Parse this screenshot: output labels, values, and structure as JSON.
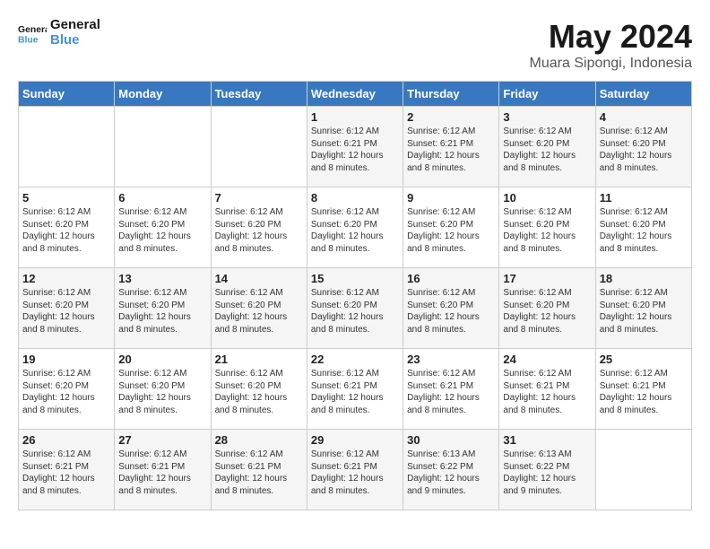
{
  "logo": {
    "line1": "General",
    "line2": "Blue"
  },
  "title": "May 2024",
  "subtitle": "Muara Sipongi, Indonesia",
  "days_of_week": [
    "Sunday",
    "Monday",
    "Tuesday",
    "Wednesday",
    "Thursday",
    "Friday",
    "Saturday"
  ],
  "weeks": [
    [
      {
        "day": "",
        "info": ""
      },
      {
        "day": "",
        "info": ""
      },
      {
        "day": "",
        "info": ""
      },
      {
        "day": "1",
        "info": "Sunrise: 6:12 AM\nSunset: 6:21 PM\nDaylight: 12 hours\nand 8 minutes."
      },
      {
        "day": "2",
        "info": "Sunrise: 6:12 AM\nSunset: 6:21 PM\nDaylight: 12 hours\nand 8 minutes."
      },
      {
        "day": "3",
        "info": "Sunrise: 6:12 AM\nSunset: 6:20 PM\nDaylight: 12 hours\nand 8 minutes."
      },
      {
        "day": "4",
        "info": "Sunrise: 6:12 AM\nSunset: 6:20 PM\nDaylight: 12 hours\nand 8 minutes."
      }
    ],
    [
      {
        "day": "5",
        "info": "Sunrise: 6:12 AM\nSunset: 6:20 PM\nDaylight: 12 hours\nand 8 minutes."
      },
      {
        "day": "6",
        "info": "Sunrise: 6:12 AM\nSunset: 6:20 PM\nDaylight: 12 hours\nand 8 minutes."
      },
      {
        "day": "7",
        "info": "Sunrise: 6:12 AM\nSunset: 6:20 PM\nDaylight: 12 hours\nand 8 minutes."
      },
      {
        "day": "8",
        "info": "Sunrise: 6:12 AM\nSunset: 6:20 PM\nDaylight: 12 hours\nand 8 minutes."
      },
      {
        "day": "9",
        "info": "Sunrise: 6:12 AM\nSunset: 6:20 PM\nDaylight: 12 hours\nand 8 minutes."
      },
      {
        "day": "10",
        "info": "Sunrise: 6:12 AM\nSunset: 6:20 PM\nDaylight: 12 hours\nand 8 minutes."
      },
      {
        "day": "11",
        "info": "Sunrise: 6:12 AM\nSunset: 6:20 PM\nDaylight: 12 hours\nand 8 minutes."
      }
    ],
    [
      {
        "day": "12",
        "info": "Sunrise: 6:12 AM\nSunset: 6:20 PM\nDaylight: 12 hours\nand 8 minutes."
      },
      {
        "day": "13",
        "info": "Sunrise: 6:12 AM\nSunset: 6:20 PM\nDaylight: 12 hours\nand 8 minutes."
      },
      {
        "day": "14",
        "info": "Sunrise: 6:12 AM\nSunset: 6:20 PM\nDaylight: 12 hours\nand 8 minutes."
      },
      {
        "day": "15",
        "info": "Sunrise: 6:12 AM\nSunset: 6:20 PM\nDaylight: 12 hours\nand 8 minutes."
      },
      {
        "day": "16",
        "info": "Sunrise: 6:12 AM\nSunset: 6:20 PM\nDaylight: 12 hours\nand 8 minutes."
      },
      {
        "day": "17",
        "info": "Sunrise: 6:12 AM\nSunset: 6:20 PM\nDaylight: 12 hours\nand 8 minutes."
      },
      {
        "day": "18",
        "info": "Sunrise: 6:12 AM\nSunset: 6:20 PM\nDaylight: 12 hours\nand 8 minutes."
      }
    ],
    [
      {
        "day": "19",
        "info": "Sunrise: 6:12 AM\nSunset: 6:20 PM\nDaylight: 12 hours\nand 8 minutes."
      },
      {
        "day": "20",
        "info": "Sunrise: 6:12 AM\nSunset: 6:20 PM\nDaylight: 12 hours\nand 8 minutes."
      },
      {
        "day": "21",
        "info": "Sunrise: 6:12 AM\nSunset: 6:20 PM\nDaylight: 12 hours\nand 8 minutes."
      },
      {
        "day": "22",
        "info": "Sunrise: 6:12 AM\nSunset: 6:21 PM\nDaylight: 12 hours\nand 8 minutes."
      },
      {
        "day": "23",
        "info": "Sunrise: 6:12 AM\nSunset: 6:21 PM\nDaylight: 12 hours\nand 8 minutes."
      },
      {
        "day": "24",
        "info": "Sunrise: 6:12 AM\nSunset: 6:21 PM\nDaylight: 12 hours\nand 8 minutes."
      },
      {
        "day": "25",
        "info": "Sunrise: 6:12 AM\nSunset: 6:21 PM\nDaylight: 12 hours\nand 8 minutes."
      }
    ],
    [
      {
        "day": "26",
        "info": "Sunrise: 6:12 AM\nSunset: 6:21 PM\nDaylight: 12 hours\nand 8 minutes."
      },
      {
        "day": "27",
        "info": "Sunrise: 6:12 AM\nSunset: 6:21 PM\nDaylight: 12 hours\nand 8 minutes."
      },
      {
        "day": "28",
        "info": "Sunrise: 6:12 AM\nSunset: 6:21 PM\nDaylight: 12 hours\nand 8 minutes."
      },
      {
        "day": "29",
        "info": "Sunrise: 6:12 AM\nSunset: 6:21 PM\nDaylight: 12 hours\nand 8 minutes."
      },
      {
        "day": "30",
        "info": "Sunrise: 6:13 AM\nSunset: 6:22 PM\nDaylight: 12 hours\nand 9 minutes."
      },
      {
        "day": "31",
        "info": "Sunrise: 6:13 AM\nSunset: 6:22 PM\nDaylight: 12 hours\nand 9 minutes."
      },
      {
        "day": "",
        "info": ""
      }
    ]
  ]
}
